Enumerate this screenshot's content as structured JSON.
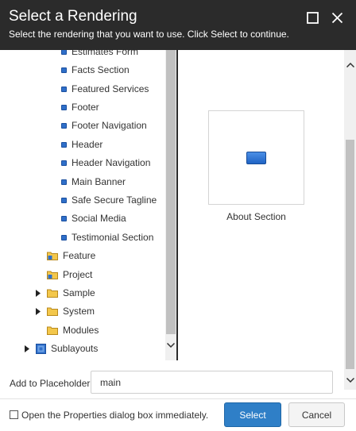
{
  "header": {
    "title": "Select a Rendering",
    "subtitle": "Select the rendering that you want to use. Click Select to continue."
  },
  "tree": {
    "renderings": [
      {
        "label": "Estimates Form",
        "icon": "rendering-icon"
      },
      {
        "label": "Facts Section",
        "icon": "rendering-icon"
      },
      {
        "label": "Featured Services",
        "icon": "rendering-icon"
      },
      {
        "label": "Footer",
        "icon": "rendering-icon"
      },
      {
        "label": "Footer Navigation",
        "icon": "rendering-icon"
      },
      {
        "label": "Header",
        "icon": "rendering-icon"
      },
      {
        "label": "Header Navigation",
        "icon": "rendering-icon"
      },
      {
        "label": "Main Banner",
        "icon": "rendering-icon"
      },
      {
        "label": "Safe Secure Tagline",
        "icon": "rendering-icon"
      },
      {
        "label": "Social Media",
        "icon": "rendering-icon"
      },
      {
        "label": "Testimonial Section",
        "icon": "rendering-icon"
      }
    ],
    "folders": [
      {
        "label": "Feature",
        "icon": "folder-icon",
        "expandable": false
      },
      {
        "label": "Project",
        "icon": "folder-icon",
        "expandable": false
      },
      {
        "label": "Sample",
        "icon": "folder-icon",
        "expandable": true
      },
      {
        "label": "System",
        "icon": "folder-icon",
        "expandable": true
      },
      {
        "label": "Modules",
        "icon": "folder-icon",
        "expandable": false
      }
    ],
    "sublayouts": {
      "label": "Sublayouts",
      "icon": "sublayouts-icon",
      "expandable": true
    }
  },
  "preview": {
    "caption": "About Section",
    "icon": "rendering-icon"
  },
  "placeholder": {
    "label": "Add to Placeholder:",
    "value": "main"
  },
  "footer": {
    "checkbox_label": "Open the Properties dialog box immediately.",
    "checkbox_checked": false,
    "select_label": "Select",
    "cancel_label": "Cancel"
  },
  "colors": {
    "header_bg": "#2b2b2b",
    "accent": "#2f7fc7"
  }
}
